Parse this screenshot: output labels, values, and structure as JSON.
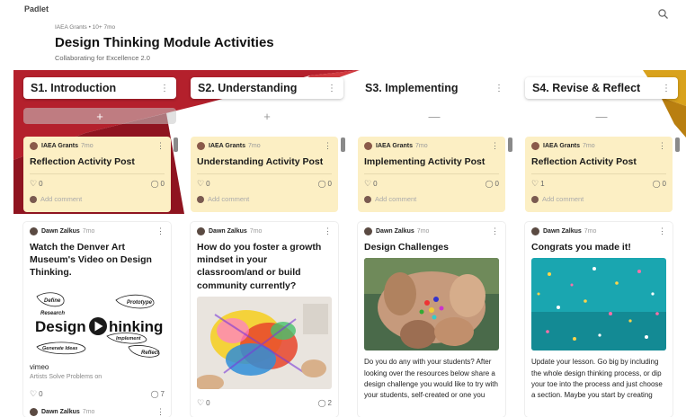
{
  "app": {
    "logo": "Padlet"
  },
  "header": {
    "meta": "IAEA Grants • 10+ 7mo",
    "title": "Design Thinking Module Activities",
    "subtitle": "Collaborating for Excellence 2.0"
  },
  "columns": [
    {
      "title": "S1. Introduction",
      "add_label": "+",
      "yellow": {
        "author": "IAEA Grants",
        "ago": "7mo",
        "title": "Reflection Activity Post",
        "likes": "0",
        "comments": "0",
        "comment_placeholder": "Add comment"
      },
      "white": {
        "author": "Dawn Zalkus",
        "ago": "7mo",
        "title": "Watch the Denver Art Museum's Video on Design Thinking.",
        "video_words": {
          "define": "Define",
          "research": "Research",
          "prototype": "Prototype",
          "generate": "Generate Ideas",
          "implement": "Implement",
          "reflect": "Reflect",
          "big_left": "Design",
          "big_right": "hinking"
        },
        "link_site": "vimeo",
        "link_caption": "Artists Solve Problems on",
        "likes": "0",
        "comments": "7"
      },
      "next_author": "Dawn Zalkus",
      "next_ago": "7mo"
    },
    {
      "title": "S2. Understanding",
      "add_label": "+",
      "yellow": {
        "author": "IAEA Grants",
        "ago": "7mo",
        "title": "Understanding Activity Post",
        "likes": "0",
        "comments": "0",
        "comment_placeholder": "Add comment"
      },
      "white": {
        "author": "Dawn Zalkus",
        "ago": "7mo",
        "title": "How do you foster a growth mindset in your classroom/and or build community currently?",
        "likes": "0",
        "comments": "2"
      }
    },
    {
      "title": "S3. Implementing",
      "add_label": "—",
      "yellow": {
        "author": "IAEA Grants",
        "ago": "7mo",
        "title": "Implementing Activity Post",
        "likes": "0",
        "comments": "0",
        "comment_placeholder": "Add comment"
      },
      "white": {
        "author": "Dawn Zalkus",
        "ago": "7mo",
        "title": "Design Challenges",
        "body": "Do you do any with your students? After looking over the resources below share a design challenge you would like to try with your students, self-created or one you"
      }
    },
    {
      "title": "S4. Revise & Reflect",
      "add_label": "—",
      "yellow": {
        "author": "IAEA Grants",
        "ago": "7mo",
        "title": "Reflection Activity Post",
        "likes": "1",
        "comments": "0",
        "comment_placeholder": "Add comment"
      },
      "white": {
        "author": "Dawn Zalkus",
        "ago": "7mo",
        "title": "Congrats you made it!",
        "body": "Update your lesson. Go big by including the whole design thinking process, or dip your toe into the process and just choose a section. Maybe you start by creating"
      }
    }
  ],
  "colors": {
    "wall_red": "#b4202c",
    "card_yellow": "#fcefc4",
    "accent_gold": "#d9a21c"
  },
  "icons": {
    "search": "search-icon",
    "more": "more-vertical-icon",
    "heart": "heart-icon",
    "comment": "comment-icon",
    "play": "play-icon"
  }
}
